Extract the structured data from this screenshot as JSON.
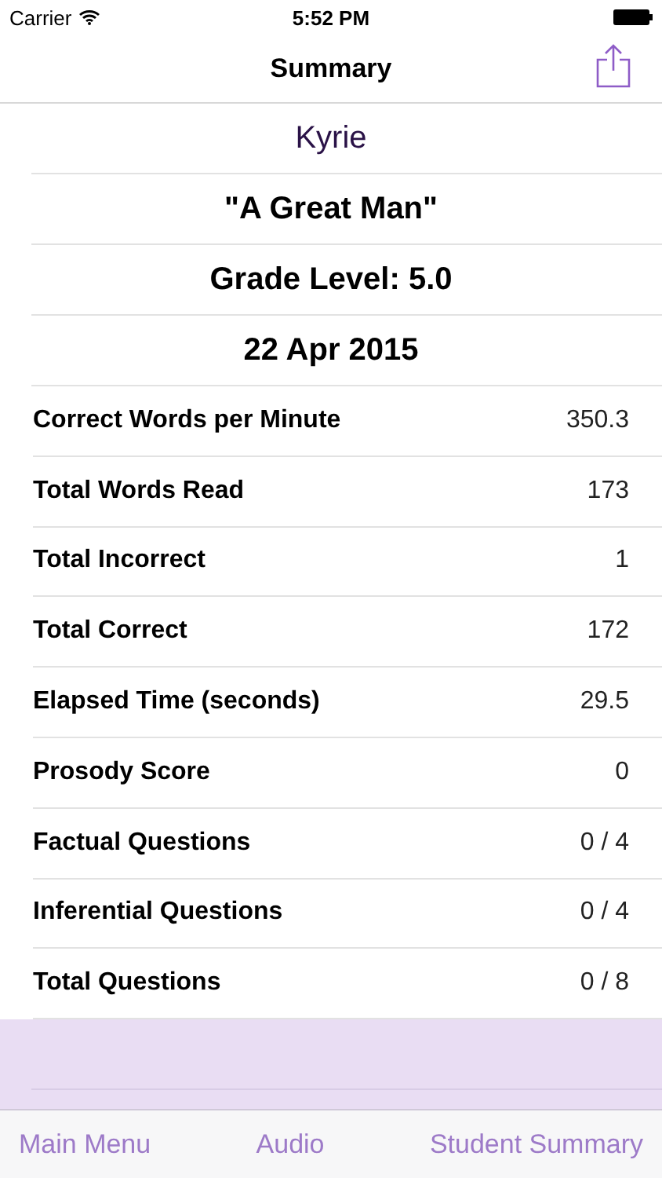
{
  "status_bar": {
    "carrier": "Carrier",
    "time": "5:52 PM"
  },
  "nav": {
    "title": "Summary"
  },
  "header": {
    "student": "Kyrie",
    "story": "\"A Great Man\"",
    "grade": "Grade Level: 5.0",
    "date": "22 Apr 2015"
  },
  "stats": [
    {
      "label": "Correct Words per Minute",
      "value": "350.3"
    },
    {
      "label": "Total Words Read",
      "value": "173"
    },
    {
      "label": "Total Incorrect",
      "value": "1"
    },
    {
      "label": "Total Correct",
      "value": "172"
    },
    {
      "label": "Elapsed Time (seconds)",
      "value": "29.5"
    },
    {
      "label": "Prosody Score",
      "value": "0"
    },
    {
      "label": "Factual Questions",
      "value": "0 / 4"
    },
    {
      "label": "Inferential Questions",
      "value": "0 / 4"
    },
    {
      "label": "Total Questions",
      "value": "0 / 8"
    }
  ],
  "toolbar": [
    "Main Menu",
    "Audio",
    "Student Summary"
  ]
}
